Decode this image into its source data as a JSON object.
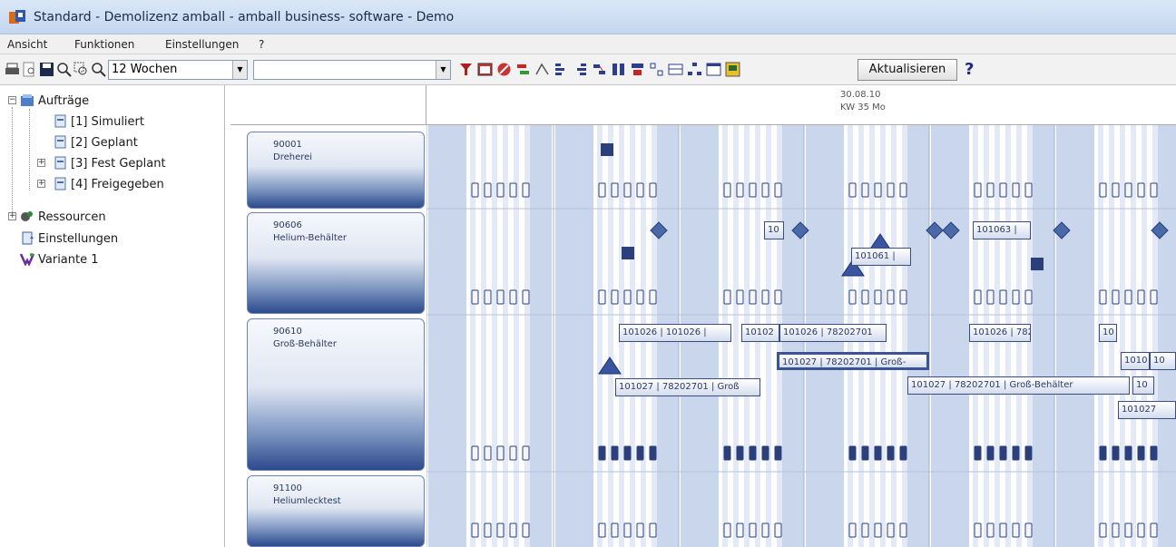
{
  "window": {
    "title": "Standard - Demolizenz amball - amball business- software - Demo"
  },
  "menu": [
    "Ansicht",
    "Funktionen",
    "Einstellungen",
    "?"
  ],
  "toolbar": {
    "period_select": "12 Wochen",
    "filter_select": "",
    "refresh_label": "Aktualisieren",
    "help_label": "?"
  },
  "tree": {
    "orders": "Aufträge",
    "simulated": "[1] Simuliert",
    "planned": "[2] Geplant",
    "firm_planned": "[3] Fest Geplant",
    "released": "[4] Freigegeben",
    "resources": "Ressourcen",
    "settings": "Einstellungen",
    "variant": "Variante 1"
  },
  "gantt": {
    "header_date": "30.08.10",
    "header_week": "KW 35 Mo",
    "resources": [
      {
        "id": "90001",
        "name": "Dreherei"
      },
      {
        "id": "90606",
        "name": "Helium-Behälter"
      },
      {
        "id": "90610",
        "name": "Groß-Behälter"
      },
      {
        "id": "91100",
        "name": "Heliumlecktest"
      }
    ],
    "orders": [
      "10",
      "101061 |",
      "101063 |",
      "101026 | 101026 |",
      "10102",
      "101026 | 78202701",
      "101026 | 782",
      "10",
      "101027 | 78202701 | Groß",
      "101027 | 78202701 | Groß-",
      "101027 | 78202701 | Groß-Behälter",
      "1010",
      "10",
      "10",
      "101027"
    ]
  }
}
